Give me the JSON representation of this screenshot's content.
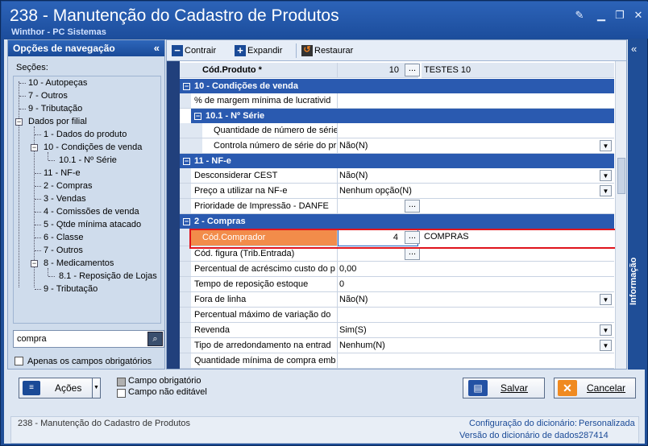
{
  "window": {
    "title": "238 - Manutenção do Cadastro de Produtos",
    "subtitle": "Winthor - PC Sistemas"
  },
  "nav": {
    "header": "Opções de navegação",
    "sections_label": "Seções:",
    "items": [
      "10 - Autopeças",
      "7 - Outros",
      "9 - Tributação",
      "Dados por filial",
      "1 - Dados do produto",
      "10 - Condições de venda",
      "10.1 - Nº Série",
      "11 - NF-e",
      "2 - Compras",
      "3 - Vendas",
      "4 - Comissões de venda",
      "5 - Qtde mínima atacado",
      "6 - Classe",
      "7 - Outros",
      "8 - Medicamentos",
      "8.1 - Reposição de Lojas",
      "9 - Tributação"
    ],
    "search_value": "compra",
    "only_required_label": "Apenas os campos obrigatórios"
  },
  "toolbar": {
    "collapse": "Contrair",
    "expand": "Expandir",
    "restore": "Restaurar"
  },
  "grid": {
    "cod_produto": {
      "label": "Cód.Produto *",
      "value": "10",
      "desc": "TESTES 10"
    },
    "sec_cond_venda": "10 - Condições de venda",
    "margem": "% de margem mínima de lucrativid",
    "sec_nserie": "10.1 - Nº Série",
    "qtd_nserie": "Quantidade de número de série",
    "ctrl_nserie": {
      "label": "Controla número de série do pr",
      "value": "Não(N)"
    },
    "sec_nfe": "11 - NF-e",
    "desconsiderar_cest": {
      "label": "Desconsiderar CEST",
      "value": "Não(N)"
    },
    "preco_nfe": {
      "label": "Preço a utilizar na NF-e",
      "value": "Nenhum opção(N)"
    },
    "prioridade_danfe": {
      "label": "Prioridade de Impressão - DANFE"
    },
    "sec_compras": "2 - Compras",
    "cod_comprador": {
      "label": "Cód.Comprador",
      "value": "4",
      "desc": "COMPRAS"
    },
    "cod_figura": {
      "label": "Cód. figura (Trib.Entrada)"
    },
    "perc_acrescimo": {
      "label": "Percentual de acréscimo custo do p",
      "value": "0,00"
    },
    "tempo_reposicao": {
      "label": "Tempo de reposição estoque",
      "value": "0"
    },
    "fora_linha": {
      "label": "Fora de linha",
      "value": "Não(N)"
    },
    "perc_variacao": {
      "label": "Percentual máximo de variação do"
    },
    "revenda": {
      "label": "Revenda",
      "value": "Sim(S)"
    },
    "tipo_arred": {
      "label": "Tipo de arredondamento na entrad",
      "value": "Nenhum(N)"
    },
    "qtd_min_compra": {
      "label": "Quantidade mínima de compra emb"
    }
  },
  "side_tab": "Informação",
  "bottom": {
    "actions": "Ações",
    "legend_required": "Campo obrigatório",
    "legend_not_editable": "Campo não editável",
    "save": "Salvar",
    "cancel": "Cancelar"
  },
  "status": {
    "left": "238 - Manutenção do Cadastro de Produtos",
    "dict_config_label": "Configuração do dicionário:",
    "dict_config_value": "Personalizada",
    "dict_version_label": "Versão do dicionário de dados:",
    "dict_version_value": "287414"
  },
  "colors": {
    "highlight_red": "#e0141c",
    "selected_orange": "#f28c4a",
    "header_blue": "#2a5ab0"
  }
}
